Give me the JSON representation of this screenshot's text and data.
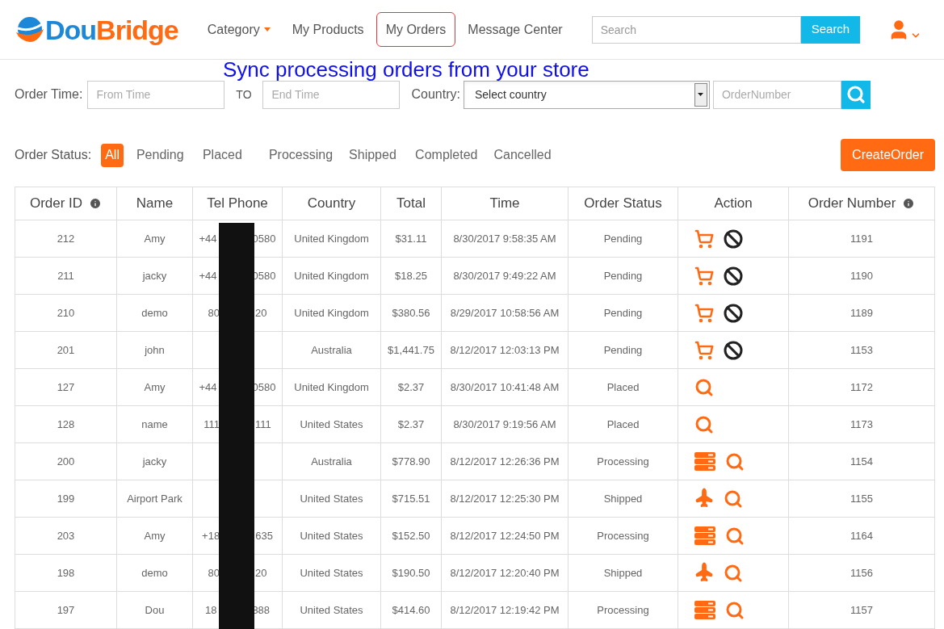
{
  "logo": {
    "part_1": "Dou",
    "part_2": "Bridge"
  },
  "nav": [
    {
      "label": "Category",
      "dropdown": true,
      "selected": false
    },
    {
      "label": "My Products",
      "dropdown": false,
      "selected": false
    },
    {
      "label": "My Orders",
      "dropdown": false,
      "selected": true
    },
    {
      "label": "Message Center",
      "dropdown": false,
      "selected": false
    }
  ],
  "search": {
    "placeholder": "Search",
    "button": "Search"
  },
  "banner": "Sync processing orders from your store",
  "filters": {
    "order_time_label": "Order Time:",
    "from_placeholder": "From Time",
    "to_label": "TO",
    "end_placeholder": "End Time",
    "country_label": "Country:",
    "country_value": "Select country",
    "order_number_placeholder": "OrderNumber"
  },
  "status_label": "Order Status:",
  "statuses": [
    {
      "label": "All",
      "selected": true
    },
    {
      "label": "Pending",
      "selected": false
    },
    {
      "label": "Placed",
      "selected": false
    },
    {
      "label": "Processing",
      "selected": false
    },
    {
      "label": "Shipped",
      "selected": false
    },
    {
      "label": "Completed",
      "selected": false
    },
    {
      "label": "Cancelled",
      "selected": false
    }
  ],
  "create_button": "CreateOrder",
  "table": {
    "columns": [
      {
        "label": "Order ID",
        "info": true
      },
      {
        "label": "Name",
        "info": false
      },
      {
        "label": "Tel Phone",
        "info": false
      },
      {
        "label": "Country",
        "info": false
      },
      {
        "label": "Total",
        "info": false
      },
      {
        "label": "Time",
        "info": false
      },
      {
        "label": "Order Status",
        "info": false
      },
      {
        "label": "Action",
        "info": false
      },
      {
        "label": "Order Number",
        "info": true
      }
    ],
    "rows": [
      {
        "id": "212",
        "name": "Amy",
        "phone_start": "+44",
        "phone_end": "0580",
        "country": "United Kingdom",
        "total": "$31.11",
        "time": "8/30/2017 9:58:35 AM",
        "status": "Pending",
        "actions": [
          {
            "kind": "cart"
          },
          {
            "kind": "cancel"
          }
        ],
        "number": "1191"
      },
      {
        "id": "211",
        "name": "jacky",
        "phone_start": "+44",
        "phone_end": "0580",
        "country": "United Kingdom",
        "total": "$18.25",
        "time": "8/30/2017 9:49:22 AM",
        "status": "Pending",
        "actions": [
          {
            "kind": "cart"
          },
          {
            "kind": "cancel"
          }
        ],
        "number": "1190"
      },
      {
        "id": "210",
        "name": "demo",
        "phone_start": "80",
        "phone_end": "20",
        "country": "United Kingdom",
        "total": "$380.56",
        "time": "8/29/2017 10:58:56 AM",
        "status": "Pending",
        "actions": [
          {
            "kind": "cart"
          },
          {
            "kind": "cancel"
          }
        ],
        "number": "1189"
      },
      {
        "id": "201",
        "name": "john",
        "country": "Australia",
        "total": "$1,441.75",
        "time": "8/12/2017 12:03:13 PM",
        "status": "Pending",
        "actions": [
          {
            "kind": "cart"
          },
          {
            "kind": "cancel"
          }
        ],
        "number": "1153"
      },
      {
        "id": "127",
        "name": "Amy",
        "phone_start": "+44",
        "phone_end": "0580",
        "country": "United Kingdom",
        "total": "$2.37",
        "time": "8/30/2017 10:41:48 AM",
        "status": "Placed",
        "actions": [
          {
            "kind": "search"
          }
        ],
        "number": "1172"
      },
      {
        "id": "128",
        "name": "name",
        "phone_start": "111",
        "phone_end": "111",
        "country": "United States",
        "total": "$2.37",
        "time": "8/30/2017 9:19:56 AM",
        "status": "Placed",
        "actions": [
          {
            "kind": "search"
          }
        ],
        "number": "1173"
      },
      {
        "id": "200",
        "name": "jacky",
        "country": "Australia",
        "total": "$778.90",
        "time": "8/12/2017 12:26:36 PM",
        "status": "Processing",
        "actions": [
          {
            "kind": "list"
          },
          {
            "kind": "search"
          }
        ],
        "number": "1154"
      },
      {
        "id": "199",
        "name": "Airport Park",
        "country": "United States",
        "total": "$715.51",
        "time": "8/12/2017 12:25:30 PM",
        "status": "Shipped",
        "actions": [
          {
            "kind": "plane"
          },
          {
            "kind": "search"
          }
        ],
        "number": "1155"
      },
      {
        "id": "203",
        "name": "Amy",
        "phone_start": "+18",
        "phone_end": "635",
        "country": "United States",
        "total": "$152.50",
        "time": "8/12/2017 12:24:50 PM",
        "status": "Processing",
        "actions": [
          {
            "kind": "list"
          },
          {
            "kind": "search"
          }
        ],
        "number": "1164"
      },
      {
        "id": "198",
        "name": "demo",
        "phone_start": "80",
        "phone_end": "20",
        "country": "United States",
        "total": "$190.50",
        "time": "8/12/2017 12:20:40 PM",
        "status": "Shipped",
        "actions": [
          {
            "kind": "plane"
          },
          {
            "kind": "search"
          }
        ],
        "number": "1156"
      },
      {
        "id": "197",
        "name": "Dou",
        "phone_start": "18",
        "phone_end": "888",
        "country": "United States",
        "total": "$414.60",
        "time": "8/12/2017 12:19:42 PM",
        "status": "Processing",
        "actions": [
          {
            "kind": "list"
          },
          {
            "kind": "search"
          }
        ],
        "number": "1157"
      }
    ]
  }
}
